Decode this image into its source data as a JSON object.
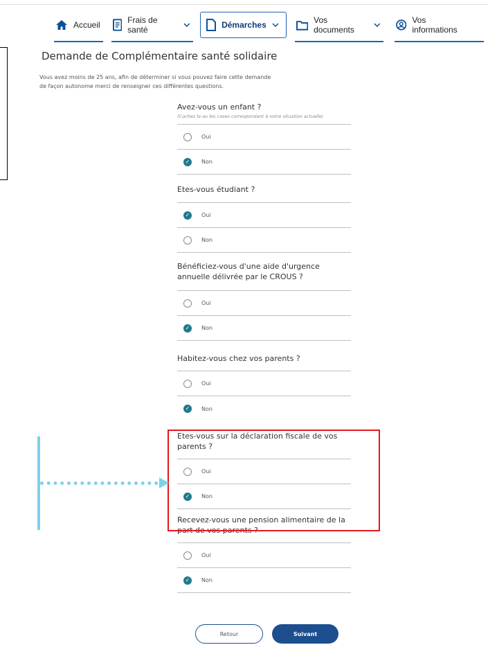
{
  "nav": {
    "items": [
      {
        "label": "Accueil"
      },
      {
        "label": "Frais de santé"
      },
      {
        "label": "Démarches"
      },
      {
        "label": "Vos documents"
      },
      {
        "label": "Vos informations"
      }
    ]
  },
  "page": {
    "title": "Demande de Complémentaire santé solidaire",
    "intro_line1": "Vous avez moins de 25 ans, afin de déterminer si vous pouvez faire cette demande",
    "intro_line2": "de façon autonome merci de renseigner ces différentes questions."
  },
  "questions": [
    {
      "text": "Avez-vous un enfant ?",
      "hint": "(Cochez la ou les cases correspondant à votre situation actuelle)",
      "oui": "Oui",
      "non": "Non",
      "selected": "non"
    },
    {
      "text": "Etes-vous étudiant ?",
      "oui": "Oui",
      "non": "Non",
      "selected": "oui"
    },
    {
      "text": "Bénéficiez-vous d'une aide d'urgence annuelle délivrée par le CROUS ?",
      "oui": "Oui",
      "non": "Non",
      "selected": "non"
    },
    {
      "text": "Habitez-vous chez vos parents ?",
      "oui": "Oui",
      "non": "Non",
      "selected": "non"
    },
    {
      "text": "Etes-vous sur la déclaration fiscale de vos parents ?",
      "oui": "Oui",
      "non": "Non",
      "selected": "non"
    },
    {
      "text": "Recevez-vous une pension alimentaire de la part de vos parents ?",
      "oui": "Oui",
      "non": "Non",
      "selected": "non"
    }
  ],
  "buttons": {
    "back": "Retour",
    "next": "Suivant"
  },
  "colors": {
    "brand": "#1d4f8f",
    "checked": "#1f7a8c",
    "highlight": "#e3171c",
    "annotation": "#7fd0ea"
  }
}
